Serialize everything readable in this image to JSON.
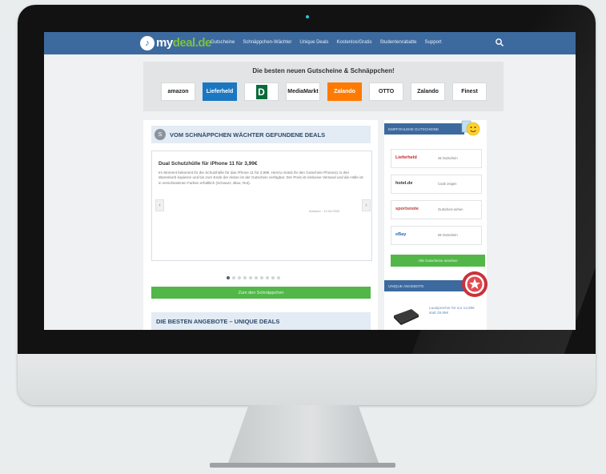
{
  "navbar": {
    "logo_badge": "♪",
    "logo_prefix": "my",
    "logo_suffix": "deal.de",
    "items": [
      "Gutscheine",
      "Schnäppchen-Wächter",
      "Unique Deals",
      "Kostenlos/Gratis",
      "Studentenrabatte",
      "Support"
    ],
    "color": "#3d6a9e"
  },
  "brand_strip": {
    "title": "Die besten neuen Gutscheine & Schnäppchen!",
    "brands": [
      "amazon",
      "Lieferheld",
      "D",
      "MediaMarkt",
      "Zalando",
      "OTTO",
      "Zalando",
      "Finest"
    ]
  },
  "main": {
    "section1_icon": "S",
    "section1_title": "VOM SCHNÄPPCHEN WÄCHTER GEFUNDENE DEALS",
    "deal_title": "Dual Schutzhülle für iPhone 11 für 3,99€",
    "deal_text": "Im Moment bekommt ihr die Schutzhülle für das iPhone 11 für 3,99€. Hierzu müsst ihr den Gutschein Phone11 in den Warenkorb kopieren und bis zum Ende der Aktion ist der Gutschein verfügbar. Der Preis ist inklusive Versand und die Hülle ist in verschiedenen Farben erhältlich (Schwarz, Blau, Rot).",
    "deal_meta": "Amazon · 12.04.2020",
    "arrow_left": "‹",
    "arrow_right": "›",
    "dots_total": 10,
    "dot_active": 0,
    "cta_label": "Zum den Schnäppchen",
    "section2_title": "DIE BESTEN ANGEBOTE – UNIQUE DEALS"
  },
  "sidebar": {
    "head1": "EMPFOHLENE GUTSCHEINE",
    "shops": [
      {
        "name": "Lieferheld",
        "text": "4€ Gutschein",
        "color": "#c0262d"
      },
      {
        "name": "hotel.de",
        "text": "Code zeigen",
        "color": "#333333"
      },
      {
        "name": "sportsnote",
        "text": "Gutschein sehen",
        "color": "#b83a3a"
      },
      {
        "name": "eBay",
        "text": "5€ Gutschein",
        "color": "#2b67b8"
      }
    ],
    "green_label": "Alle Gutscheine ansehen",
    "head2": "UNIQUE ANGEBOTE",
    "product_text": "Lautsprecher für nur 14,99€ statt 29,99€"
  },
  "colors": {
    "accent_blue": "#3d6a9e",
    "accent_green": "#52b748"
  }
}
